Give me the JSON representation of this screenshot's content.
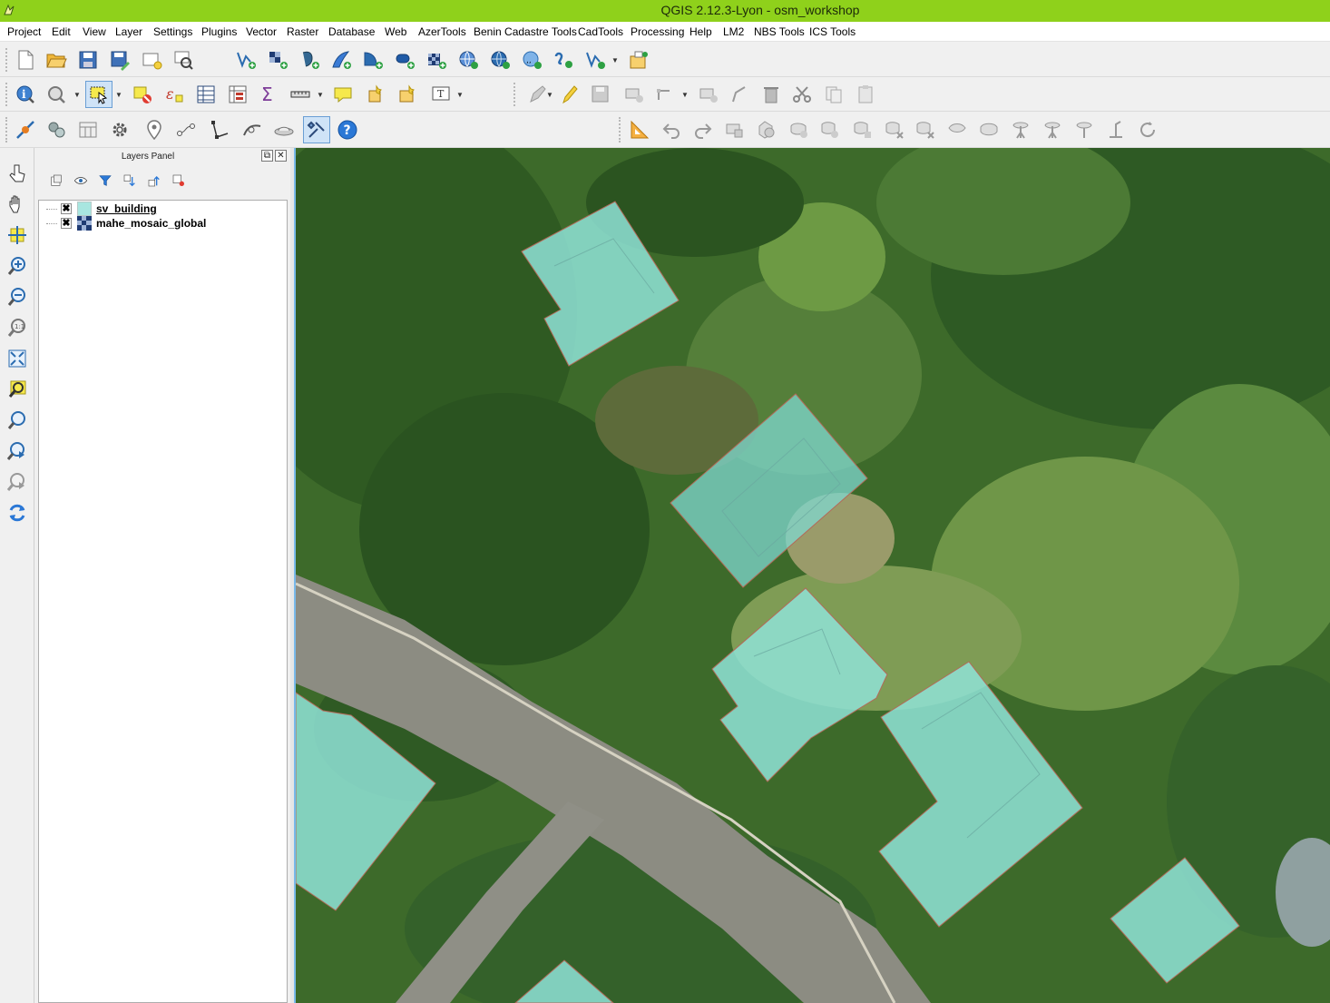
{
  "window": {
    "title": "QGIS 2.12.3-Lyon - osm_workshop"
  },
  "menubar": {
    "items": [
      "Project",
      "Edit",
      "View",
      "Layer",
      "Settings",
      "Plugins",
      "Vector",
      "Raster",
      "Database",
      "Web",
      "AzerTools",
      "Benin Cadastre Tools",
      "CadTools",
      "Processing",
      "Help",
      "LM2",
      "NBS Tools",
      "ICS Tools"
    ]
  },
  "layers_panel": {
    "title": "Layers Panel",
    "float_glyph": "⧉",
    "close_glyph": "✕",
    "layers": [
      {
        "name": "sv_building",
        "visible": true,
        "check_glyph": "✖",
        "swatch_color": "#a8e6e0",
        "swatch_type": "polygon"
      },
      {
        "name": "mahe_mosaic_global",
        "visible": true,
        "check_glyph": "✖",
        "swatch_color": "#1f3b73",
        "swatch_type": "raster"
      }
    ]
  },
  "icons": {
    "file_toolbar": [
      "new-project-icon",
      "open-project-icon",
      "save-project-icon",
      "save-as-icon",
      "new-print-composer-icon",
      "composer-manager-icon",
      "add-vector-layer-icon",
      "add-raster-layer-icon",
      "add-postgis-layer-icon",
      "add-spatialite-layer-icon",
      "add-mssql-layer-icon",
      "add-oracle-layer-icon",
      "add-wms-layer-icon",
      "add-wcs-layer-icon",
      "add-wfs-layer-icon",
      "add-delimited-text-icon",
      "new-shapefile-icon",
      "add-virtual-layer-icon"
    ],
    "attributes_toolbar": [
      "identify-icon",
      "pan-to-selection-icon",
      "select-features-icon",
      "deselect-icon",
      "select-by-expression-icon",
      "attribute-table-icon",
      "field-calculator-icon",
      "statistical-summary-icon",
      "measure-line-icon",
      "map-tips-icon",
      "new-bookmark-icon",
      "show-bookmarks-icon",
      "text-annotation-icon"
    ],
    "digitizing_toolbar": [
      "current-edits-icon",
      "toggle-editing-icon",
      "save-edits-icon",
      "add-feature-icon",
      "node-tool-icon",
      "move-feature-icon",
      "delete-selected-icon",
      "cut-features-icon",
      "copy-features-icon",
      "paste-features-icon"
    ],
    "plugins_toolbar": [
      "openlayers-icon",
      "processing-commander-icon",
      "toolbox-icon",
      "settings-gear-icon",
      "georeferencer-icon",
      "routing-icon",
      "cadtools-icon",
      "vertex-tool-icon",
      "globe-icon",
      "cadastre-tools-icon",
      "help-icon"
    ],
    "advanced_digitizing_toolbar": [
      "cad-digitizing-icon",
      "undo-icon",
      "redo-icon",
      "rotate-feature-icon",
      "simplify-feature-icon",
      "add-ring-icon",
      "add-part-icon",
      "fill-ring-icon",
      "delete-ring-icon",
      "delete-part-icon",
      "reshape-features-icon",
      "offset-curve-icon",
      "split-features-icon",
      "split-parts-icon",
      "merge-features-icon",
      "merge-attributes-icon",
      "rotate-point-symbols-icon"
    ],
    "map_nav_toolbar": [
      "touch-zoom-icon",
      "pan-map-icon",
      "pan-to-selection-icon",
      "zoom-in-icon",
      "zoom-out-icon",
      "zoom-native-icon",
      "zoom-full-icon",
      "zoom-to-selection-icon",
      "zoom-to-layer-icon",
      "zoom-last-icon",
      "zoom-next-icon",
      "refresh-icon"
    ]
  },
  "colors": {
    "titlebar": "#8fd11b",
    "building_fill": "#8fe3d7",
    "building_outline": "#b36a5a",
    "road": "#8a8a80",
    "vegetation": "#3f6428"
  }
}
